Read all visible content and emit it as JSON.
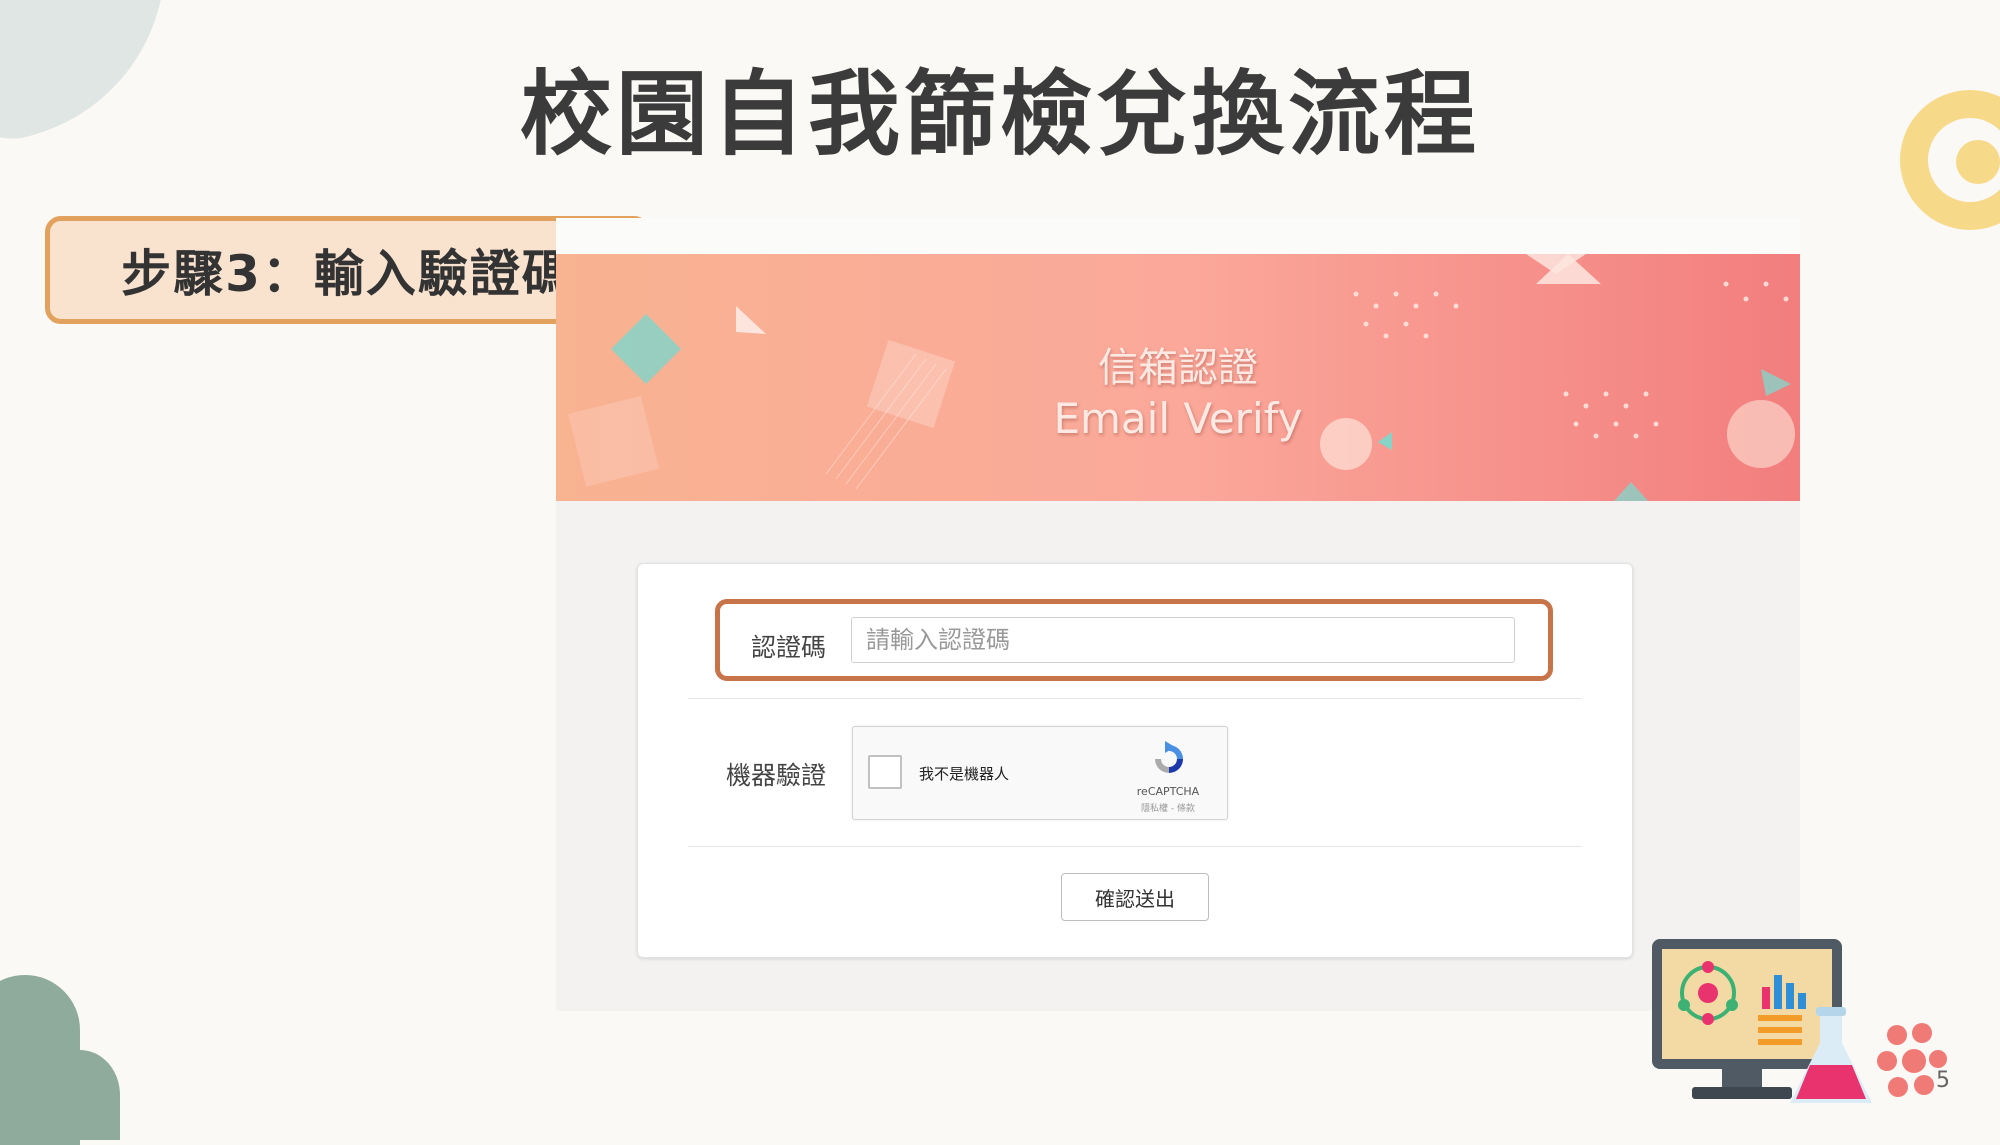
{
  "slide": {
    "title": "校園自我篩檢兌換流程",
    "step_label": "步驟3：輸入驗證碼",
    "page_number": "5"
  },
  "banner": {
    "title": "信箱認證",
    "subtitle": "Email Verify"
  },
  "form": {
    "code_label": "認證碼",
    "code_placeholder": "請輸入認證碼",
    "code_value": "",
    "robot_label": "機器驗證",
    "submit_label": "確認送出"
  },
  "recaptcha": {
    "checkbox_label": "我不是機器人",
    "brand": "reCAPTCHA",
    "links": "隱私權 - 條款",
    "checked": false
  },
  "colors": {
    "highlight": "#c8744a",
    "step_border": "#e2a25e",
    "step_fill": "#f9e3cf",
    "banner_left": "#f8b391",
    "banner_right": "#f27e7e"
  },
  "icons": {
    "recaptcha_logo": "recaptcha-logo-icon",
    "illustration": "science-computer-icon"
  }
}
